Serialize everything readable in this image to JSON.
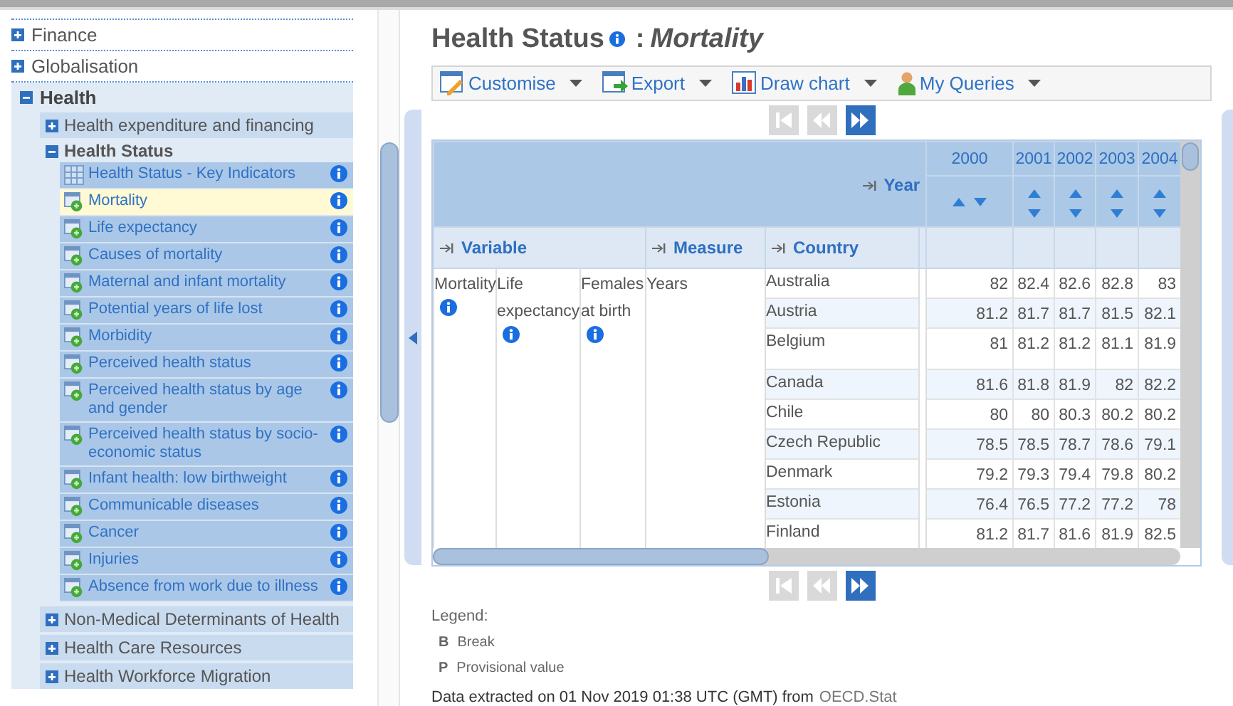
{
  "sidebar": {
    "items": [
      {
        "label": "Finance",
        "expanded": false
      },
      {
        "label": "Globalisation",
        "expanded": false
      },
      {
        "label": "Health",
        "expanded": true,
        "children": [
          {
            "label": "Health expenditure and financing",
            "expanded": false
          },
          {
            "label": "Health Status",
            "expanded": true,
            "children": [
              {
                "label": "Health Status - Key Indicators",
                "kind": "table",
                "selected": false
              },
              {
                "label": "Mortality",
                "kind": "query",
                "selected": true
              },
              {
                "label": "Life expectancy",
                "kind": "query",
                "selected": false
              },
              {
                "label": "Causes of mortality",
                "kind": "query",
                "selected": false
              },
              {
                "label": "Maternal and infant mortality",
                "kind": "query",
                "selected": false
              },
              {
                "label": "Potential years of life lost",
                "kind": "query",
                "selected": false
              },
              {
                "label": "Morbidity",
                "kind": "query",
                "selected": false
              },
              {
                "label": "Perceived health status",
                "kind": "query",
                "selected": false
              },
              {
                "label": "Perceived health status by age and gender",
                "kind": "query",
                "selected": false
              },
              {
                "label": "Perceived health status by socio-economic status",
                "kind": "query",
                "selected": false
              },
              {
                "label": "Infant health: low birthweight",
                "kind": "query",
                "selected": false
              },
              {
                "label": "Communicable diseases",
                "kind": "query",
                "selected": false
              },
              {
                "label": "Cancer",
                "kind": "query",
                "selected": false
              },
              {
                "label": "Injuries",
                "kind": "query",
                "selected": false
              },
              {
                "label": "Absence from work due to illness",
                "kind": "query",
                "selected": false
              }
            ]
          },
          {
            "label": "Non-Medical Determinants of Health",
            "expanded": false
          },
          {
            "label": "Health Care Resources",
            "expanded": false
          },
          {
            "label": "Health Workforce Migration",
            "expanded": false
          }
        ]
      }
    ]
  },
  "title": {
    "dataset": "Health Status",
    "separator": ":",
    "subtitle": "Mortality"
  },
  "toolbar": [
    {
      "label": "Customise",
      "kind": "customise"
    },
    {
      "label": "Export",
      "kind": "export"
    },
    {
      "label": "Draw chart",
      "kind": "chart"
    },
    {
      "label": "My Queries",
      "kind": "queries"
    }
  ],
  "pagers": [
    [
      {
        "kind": "first",
        "disabled": true
      },
      {
        "kind": "prev",
        "disabled": true
      },
      {
        "kind": "next",
        "disabled": false
      }
    ],
    [
      {
        "kind": "first",
        "disabled": true
      },
      {
        "kind": "prev",
        "disabled": true
      },
      {
        "kind": "next",
        "disabled": false
      }
    ]
  ],
  "table": {
    "year_header": "Year",
    "years": [
      "2000",
      "2001",
      "2002",
      "2003",
      "2004"
    ],
    "dimension_headers": [
      "Variable",
      "Measure",
      "Country"
    ],
    "variable": [
      "Mortality",
      "Life expectancy",
      "Females at birth"
    ],
    "measure": "Years",
    "rows": [
      {
        "country": "Australia",
        "values": [
          "82",
          "82.4",
          "82.6",
          "82.8",
          "83"
        ]
      },
      {
        "country": "Austria",
        "values": [
          "81.2",
          "81.7",
          "81.7",
          "81.5",
          "82.1"
        ]
      },
      {
        "country": "Belgium",
        "values": [
          "81",
          "81.2",
          "81.2",
          "81.1",
          "81.9"
        ]
      },
      {
        "country": "Canada",
        "values": [
          "81.6",
          "81.8",
          "81.9",
          "82",
          "82.2"
        ]
      },
      {
        "country": "Chile",
        "values": [
          "80",
          "80",
          "80.3",
          "80.2",
          "80.2"
        ]
      },
      {
        "country": "Czech Republic",
        "values": [
          "78.5",
          "78.5",
          "78.7",
          "78.6",
          "79.1"
        ]
      },
      {
        "country": "Denmark",
        "values": [
          "79.2",
          "79.3",
          "79.4",
          "79.8",
          "80.2"
        ]
      },
      {
        "country": "Estonia",
        "values": [
          "76.4",
          "76.5",
          "77.2",
          "77.2",
          "78"
        ]
      },
      {
        "country": "Finland",
        "values": [
          "81.2",
          "81.7",
          "81.6",
          "81.9",
          "82.5"
        ]
      }
    ]
  },
  "legend": {
    "title": "Legend:",
    "items": [
      {
        "code": "B",
        "label": "Break"
      },
      {
        "code": "P",
        "label": "Provisional value"
      }
    ]
  },
  "footer": {
    "text": "Data extracted on 01 Nov 2019 01:38 UTC (GMT) from",
    "link": "OECD.Stat"
  }
}
